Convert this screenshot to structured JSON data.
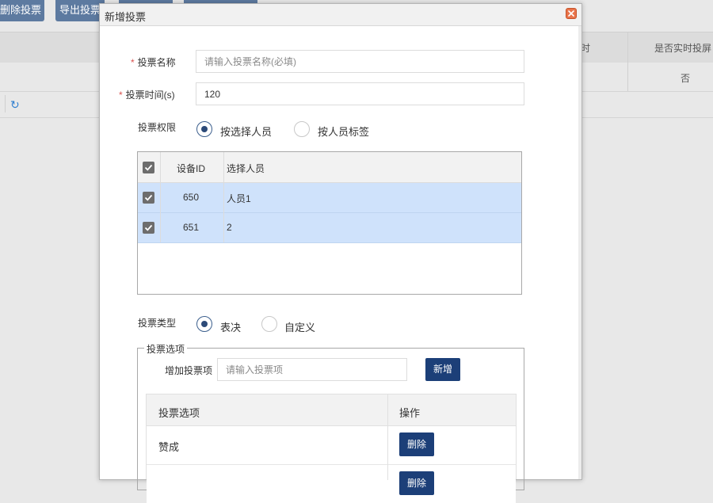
{
  "background": {
    "toolbar": {
      "delete_label": "删除投票",
      "export_label": "导出投票"
    },
    "table": {
      "col_realtime_header": "是否实时投屏",
      "col_time_header_fragment": "时",
      "row1_realtime": "否"
    }
  },
  "dialog": {
    "title": "新增投票",
    "fields": {
      "name_label": "投票名称",
      "name_placeholder": "请输入投票名称(必填)",
      "name_value": "",
      "time_label": "投票时间(s)",
      "time_value": "120",
      "permission_label": "投票权限",
      "permission_options": [
        "按选择人员",
        "按人员标签"
      ],
      "permission_selected": "按选择人员"
    },
    "person_table": {
      "headers": [
        "设备ID",
        "选择人员"
      ],
      "rows": [
        {
          "device_id": "650",
          "person": "人员1",
          "checked": true
        },
        {
          "device_id": "651",
          "person": "2",
          "checked": true
        }
      ]
    },
    "vote_type": {
      "label": "投票类型",
      "options": [
        "表决",
        "自定义"
      ],
      "selected": "表决"
    },
    "vote_options": {
      "legend": "投票选项",
      "add_label": "增加投票项",
      "add_placeholder": "请输入投票项",
      "add_button": "新增",
      "headers": [
        "投票选项",
        "操作"
      ],
      "rows": [
        {
          "option": "赞成",
          "action": "删除"
        },
        {
          "option": "",
          "action": "删除"
        }
      ]
    }
  },
  "colors": {
    "accent": "#1c3f78",
    "selected_row": "#cfe2fb",
    "required": "#d9534f",
    "toolbar_button": "#5d7aa0"
  }
}
